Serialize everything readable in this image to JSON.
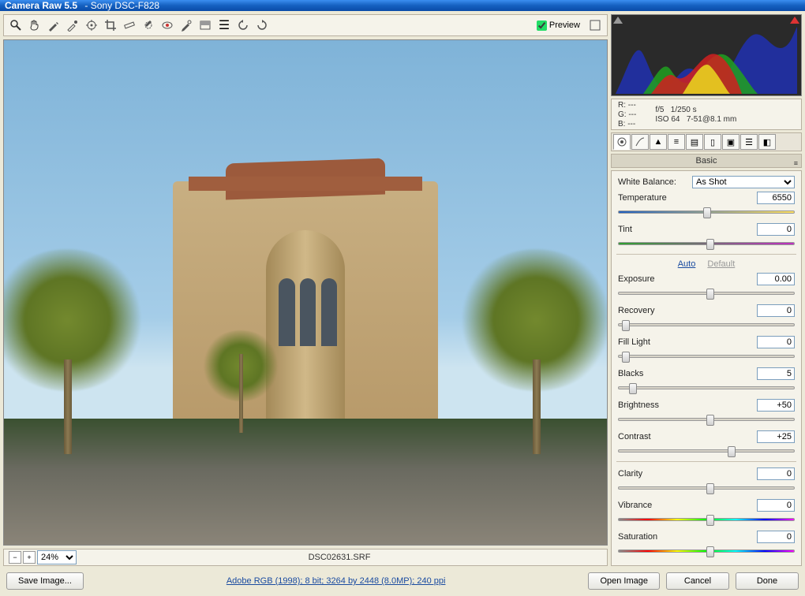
{
  "window": {
    "app_title": "Camera Raw 5.5",
    "doc_title": "Sony DSC-F828"
  },
  "toolbar": {
    "preview_label": "Preview",
    "preview_checked": true
  },
  "zoom": {
    "value": "24%"
  },
  "filename": "DSC02631.SRF",
  "metadata": {
    "r": "R:  ---",
    "g": "G:  ---",
    "b": "B:  ---",
    "aperture": "f/5",
    "shutter": "1/250 s",
    "iso": "ISO 64",
    "lens": "7-51@8.1 mm"
  },
  "panel": {
    "title": "Basic",
    "white_balance_label": "White Balance:",
    "white_balance_value": "As Shot",
    "auto_label": "Auto",
    "default_label": "Default",
    "sliders": {
      "temperature": {
        "label": "Temperature",
        "value": "6550",
        "pos": 48
      },
      "tint": {
        "label": "Tint",
        "value": "0",
        "pos": 50
      },
      "exposure": {
        "label": "Exposure",
        "value": "0.00",
        "pos": 50
      },
      "recovery": {
        "label": "Recovery",
        "value": "0",
        "pos": 2
      },
      "fill_light": {
        "label": "Fill Light",
        "value": "0",
        "pos": 2
      },
      "blacks": {
        "label": "Blacks",
        "value": "5",
        "pos": 6
      },
      "brightness": {
        "label": "Brightness",
        "value": "+50",
        "pos": 50
      },
      "contrast": {
        "label": "Contrast",
        "value": "+25",
        "pos": 62
      },
      "clarity": {
        "label": "Clarity",
        "value": "0",
        "pos": 50
      },
      "vibrance": {
        "label": "Vibrance",
        "value": "0",
        "pos": 50
      },
      "saturation": {
        "label": "Saturation",
        "value": "0",
        "pos": 50
      }
    }
  },
  "buttons": {
    "save_image": "Save Image...",
    "open_image": "Open Image",
    "cancel": "Cancel",
    "done": "Done"
  },
  "footer_link": "Adobe RGB (1998); 8 bit; 3264 by 2448 (8.0MP); 240 ppi"
}
